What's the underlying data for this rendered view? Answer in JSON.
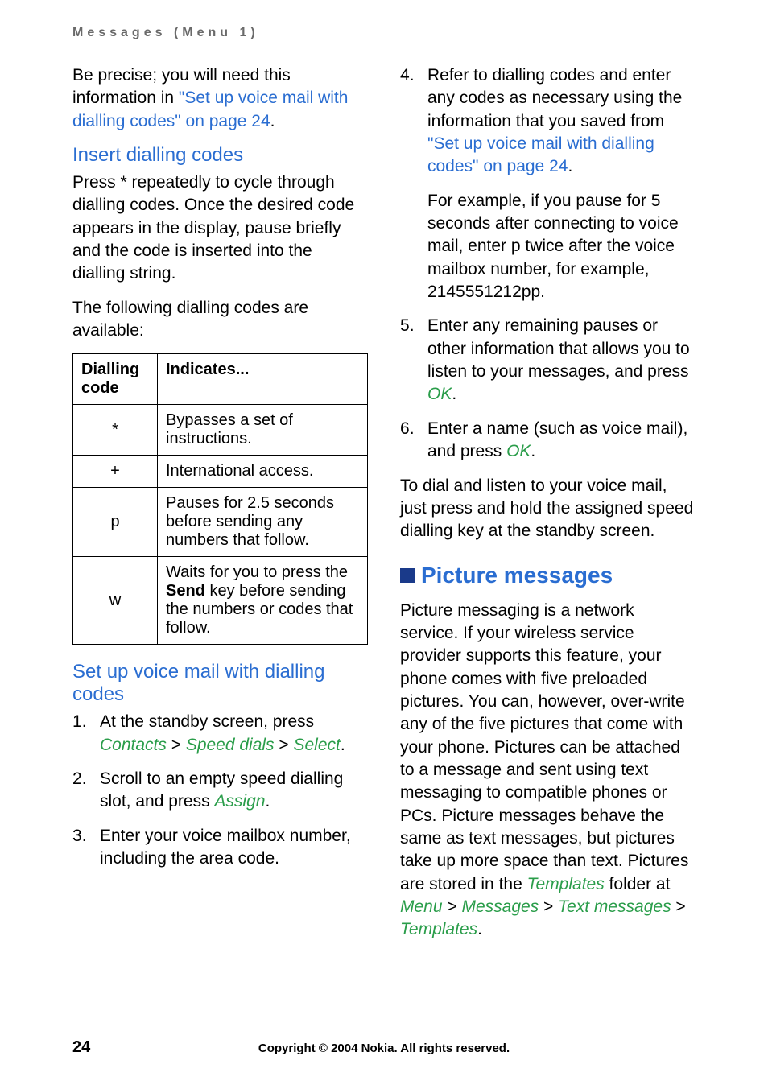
{
  "header": "Messages (Menu 1)",
  "left": {
    "p1_a": "Be precise; you will need this information in ",
    "p1_link": "\"Set up voice mail with dialling codes\" on page 24",
    "p1_b": ".",
    "h_insert": "Insert dialling codes",
    "p2": "Press * repeatedly to cycle through dialling codes. Once the desired code appears in the display, pause briefly and the code is inserted into the dialling string.",
    "p3": "The following dialling codes are available:",
    "table": {
      "th1": "Dialling code",
      "th2": "Indicates...",
      "rows": [
        {
          "code": "*",
          "desc": "Bypasses a set of instructions."
        },
        {
          "code": "+",
          "desc": "International access."
        },
        {
          "code": "p",
          "desc": "Pauses for 2.5 seconds before sending any numbers that follow."
        },
        {
          "code": "w",
          "desc_a": "Waits for you to press the ",
          "desc_bold": "Send",
          "desc_b": " key before sending the numbers or codes that follow."
        }
      ]
    },
    "h_setup": "Set up voice mail with dialling codes",
    "ol": {
      "i1_a": "At the standby screen, press ",
      "i1_contacts": "Contacts",
      "i1_gt1": " > ",
      "i1_speed": "Speed dials",
      "i1_gt2": " > ",
      "i1_select": "Select",
      "i1_b": ".",
      "i2_a": "Scroll to an empty speed dialling slot, and press ",
      "i2_assign": "Assign",
      "i2_b": ".",
      "i3": "Enter your voice mailbox number, including the area code."
    }
  },
  "right": {
    "ol": {
      "i4_a": "Refer to dialling codes and enter any codes as necessary using the information that you saved from ",
      "i4_link": "\"Set up voice mail with dialling codes\" on page 24",
      "i4_b": ".",
      "i4_sub": "For example, if you pause for 5 seconds after connecting to voice mail, enter p twice after the voice mailbox number, for example, 2145551212pp.",
      "i5_a": "Enter any remaining pauses or other information that allows you to listen to your messages, and press ",
      "i5_ok": "OK",
      "i5_b": ".",
      "i6_a": "Enter a name (such as voice mail), and press ",
      "i6_ok": "OK",
      "i6_b": "."
    },
    "p1": "To dial and listen to your voice mail, just press and hold the assigned speed dialling key at the standby screen.",
    "section": "Picture messages",
    "p2_a": "Picture messaging is a network service. If your wireless service provider supports this feature, your phone comes with five preloaded pictures. You can, however, over-write any of the five pictures that come with your phone. Pictures can be attached to a message and sent using text messaging to compatible phones or PCs. Picture messages behave the same as text messages, but pictures take up more space than text. Pictures are stored in the ",
    "p2_templates1": "Templates",
    "p2_b": " folder at ",
    "p2_menu": "Menu",
    "p2_gt1": " > ",
    "p2_messages": "Messages",
    "p2_gt2": " > ",
    "p2_text": "Text messages",
    "p2_gt3": " > ",
    "p2_templates2": "Templates",
    "p2_c": "."
  },
  "footer": {
    "page": "24",
    "copyright": "Copyright © 2004 Nokia. All rights reserved."
  }
}
